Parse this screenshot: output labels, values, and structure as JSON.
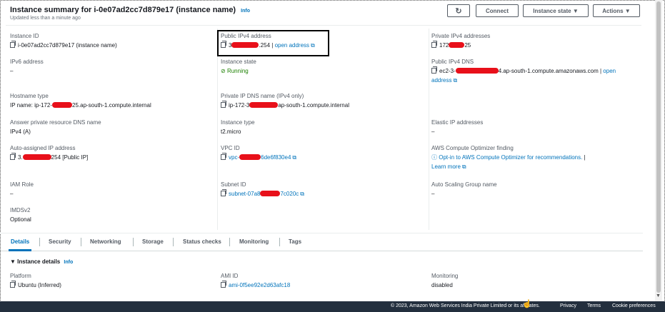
{
  "header": {
    "title": "Instance summary for i-0e07ad2cc7d879e17 (instance name)",
    "info": "Info",
    "updated": "Updated less than a minute ago",
    "connect_label": "Connect",
    "instance_state_label": "Instance state ▼",
    "actions_label": "Actions ▼"
  },
  "fields": {
    "instance_id": {
      "label": "Instance ID",
      "value": "i-0e07ad2cc7d879e17 (instance name)"
    },
    "public_ipv4": {
      "label": "Public IPv4 address",
      "prefix": "3",
      "suffix": ".254 |",
      "link": "open address"
    },
    "private_ipv4": {
      "label": "Private IPv4 addresses",
      "prefix": "172",
      "suffix": "25"
    },
    "ipv6": {
      "label": "IPv6 address",
      "value": "–"
    },
    "instance_state": {
      "label": "Instance state",
      "value": "Running"
    },
    "public_dns": {
      "label": "Public IPv4 DNS",
      "prefix": "ec2-3-",
      "suffix": "4.ap-south-1.compute.amazonaws.com |",
      "link1": "open",
      "link2": "address"
    },
    "hostname_type": {
      "label": "Hostname type",
      "prefix": "IP name: ip-172-",
      "suffix": "25.ap-south-1.compute.internal"
    },
    "private_dns": {
      "label": "Private IP DNS name (IPv4 only)",
      "prefix": "ip-172-3",
      "suffix": "ap-south-1.compute.internal"
    },
    "answer_dns": {
      "label": "Answer private resource DNS name",
      "value": "IPv4 (A)"
    },
    "instance_type": {
      "label": "Instance type",
      "value": "t2.micro"
    },
    "elastic_ip": {
      "label": "Elastic IP addresses",
      "value": "–"
    },
    "auto_ip": {
      "label": "Auto-assigned IP address",
      "prefix": "3.",
      "suffix": "254 [Public IP]"
    },
    "vpc_id": {
      "label": "VPC ID",
      "prefix": "vpc-",
      "suffix": "6de6f830e4"
    },
    "optimizer": {
      "label": "AWS Compute Optimizer finding",
      "value": "Opt-in to AWS Compute Optimizer for recommendations.",
      "sep": "|",
      "learn": "Learn more"
    },
    "iam_role": {
      "label": "IAM Role",
      "value": "–"
    },
    "subnet_id": {
      "label": "Subnet ID",
      "prefix": "subnet-07a8",
      "suffix": "7c020c"
    },
    "asg_name": {
      "label": "Auto Scaling Group name",
      "value": "–"
    },
    "imdsv2": {
      "label": "IMDSv2",
      "value": "Optional"
    }
  },
  "tabs": [
    "Details",
    "Security",
    "Networking",
    "Storage",
    "Status checks",
    "Monitoring",
    "Tags"
  ],
  "details_section": {
    "title": "▼ Instance details",
    "info": "Info",
    "platform": {
      "label": "Platform",
      "value": "Ubuntu (Inferred)"
    },
    "ami_id": {
      "label": "AMI ID",
      "value": "ami-0f5ee92e2d63afc18"
    },
    "monitoring": {
      "label": "Monitoring",
      "value": "disabled"
    }
  },
  "footer": {
    "copyright": "© 2023, Amazon Web Services India Private Limited or its affiliates.",
    "privacy": "Privacy",
    "terms": "Terms",
    "cookies": "Cookie preferences"
  },
  "colors": {
    "link": "#0073bb",
    "running": "#1d8102",
    "footer_bg": "#232f3e",
    "redaction": "#e8101a"
  }
}
